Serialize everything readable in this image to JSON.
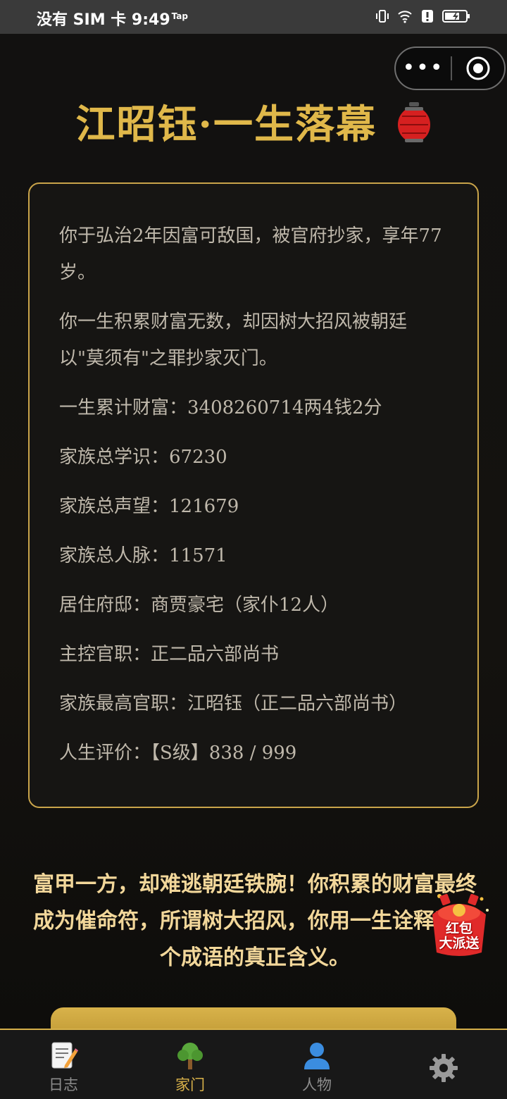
{
  "status_bar": {
    "carrier_time": "没有 SIM 卡 9:49",
    "tap_badge": "Tap",
    "icons": [
      "vibrate-icon",
      "wifi-icon",
      "alert-icon",
      "battery-charging-icon"
    ]
  },
  "capsule": {
    "more_label": "•••",
    "icons": [
      "more-icon",
      "target-icon"
    ]
  },
  "header": {
    "title": "江昭钰·一生落幕",
    "title_icon": "lantern-icon"
  },
  "summary": {
    "paragraphs": [
      "你于弘治2年因富可敌国，被官府抄家，享年77岁。",
      "你一生积累财富无数，却因树大招风被朝廷以\"莫须有\"之罪抄家灭门。"
    ],
    "stats": [
      "一生累计财富：3408260714两4钱2分",
      "家族总学识：67230",
      "家族总声望：121679",
      "家族总人脉：11571",
      "居住府邸：商贾豪宅（家仆12人）",
      "主控官职：正二品六部尚书",
      "家族最高官职：江昭钰（正二品六部尚书）",
      "人生评价：【S级】838 / 999"
    ]
  },
  "verdict": "富甲一方，却难逃朝廷铁腕！你积累的财富最终成为催命符，所谓树大招风，你用一生诠释了这个成语的真正含义。",
  "red_packet": {
    "label_line1": "红包",
    "label_line2": "大派送"
  },
  "tabs": [
    {
      "label": "日志",
      "icon": "notepad-icon",
      "active": false
    },
    {
      "label": "家门",
      "icon": "tree-icon",
      "active": true
    },
    {
      "label": "人物",
      "icon": "person-icon",
      "active": false
    },
    {
      "label": "",
      "icon": "gear-icon",
      "active": false
    }
  ],
  "colors": {
    "accent_gold": "#e0b84a",
    "verdict_text": "#f2d79a",
    "card_border": "#c9a44a"
  }
}
